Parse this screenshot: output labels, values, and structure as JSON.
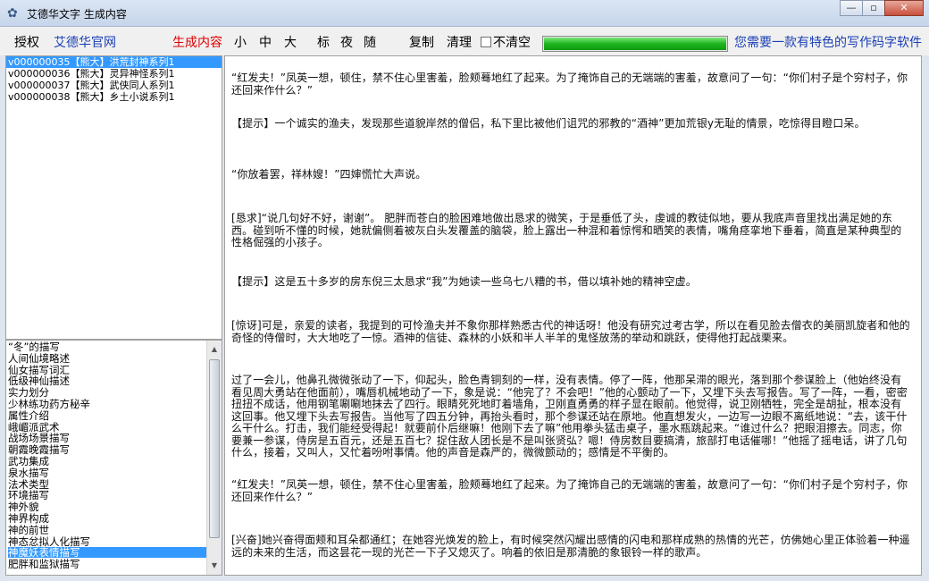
{
  "window": {
    "title": "艾德华文字 生成内容",
    "minimize": "—",
    "maximize": "▫",
    "close": "✕"
  },
  "toolbar": {
    "auth": "授权",
    "official": "艾德华官网",
    "generate": "生成内容",
    "size_small": "小",
    "size_mid": "中",
    "size_large": "大",
    "style_std": "标",
    "style_night": "夜",
    "style_random": "随",
    "copy": "复制",
    "clear": "清理",
    "no_clear": "不清空",
    "progress_pct": 100,
    "slogan": "您需要一款有特色的写作码字软件"
  },
  "list": [
    {
      "text": "v000000035【熊大】洪荒封神系列1",
      "selected": true
    },
    {
      "text": "v000000036【熊大】灵异神怪系列1",
      "selected": false
    },
    {
      "text": "v000000037【熊大】武侠同人系列1",
      "selected": false
    },
    {
      "text": "v000000038【熊大】乡土小说系列1",
      "selected": false
    }
  ],
  "sidebar": [
    "“冬”的描写",
    "人间仙境略述",
    "仙女描写词汇",
    "低级神仙描述",
    "实力划分",
    "少林练功药方秘辛",
    "属性介绍",
    "峨嵋派武术",
    "战场场景描写",
    "朝霞晚霞描写",
    "武功集成",
    "泉水描写",
    "法术类型",
    "环境描写",
    "神外貌",
    "神界构成",
    "神的前世",
    "神态忿拟人化描写",
    "神魔妖表情描写",
    "肥胖和监狱描写"
  ],
  "sidebar_selected": 18,
  "paragraphs": [
    "“红发夫！”凤英一想，顿住，禁不住心里害羞，脸颊蓦地红了起来。为了掩饰自己的无端端的害羞，故意问了一句：“你们村子是个穷村子，你还回来作什么？”",
    "【提示】一个诚实的渔夫，发现那些道貌岸然的僧侣，私下里比被他们诅咒的邪教的“酒神”更加荒银y无耻的情景，吃惊得目瞪口呆。",
    "“你放着罢，祥林嫂！”四婶慌忙大声说。",
    "[恳求]“说几句好不好，谢谢”。 肥胖而苍白的脸困难地做出恳求的微笑，于是垂低了头，虔诚的教徒似地，要从我底声音里找出满足她的东西。碰到听不懂的时候，她就偏侧着被灰白头发覆盖的脑袋，脸上露出一种混和着惊愕和晒笑的表情，嘴角痉挛地下垂着，简直是某种典型的性格倔强的小孩子。",
    "【提示】这是五十多岁的房东倪三太恳求“我”为她读一些乌七八糟的书，借以填补她的精神空虚。",
    "[惊讶]可是，亲爱的读者，我提到的可怜渔夫并不象你那样熟悉古代的神话呀！他没有研究过考古学，所以在看见脸去僧衣的美丽凯旋者和他的奇怪的侍僧时，大大地吃了一惊。酒神的信徒、森林的小妖和半人半羊的鬼怪放荡的举动和跳跃，使得他打起战栗来。",
    "过了一会儿，他鼻孔微微张动了一下，仰起头，脸色青铜刻的一样，没有表情。停了一阵，他那呆滞的眼光，落到那个参谋脸上（他始终没有看见周大勇站在他面前），嘴唇机械地动了一下，象是说：“他完了？不会吧！”他的心颤动了一下，又埋下头去写报告。写了一阵，一看，密密扭扭不成话，他用钢笔唰唰地抹去了四行。眼睛死死地盯着墙角，卫刚直勇勇的样子显在眼前。他觉得，说卫刚牺牲，完全是胡扯，根本没有这回事。他又埋下头去写报告。当他写了四五分钟，再抬头看时，那个参谋还站在原地。他直想发火，一边写一边眼不离纸地说：“去，该干什么干什么。打击，我们能经受得起！就要前仆后继嘛！他刚下去了嘛”他用拳头猛击桌子，墨水瓶跳起来。“谁过什么？把眼泪擦去。同志，你要兼一参谋，侍房是五百元，还是五百七？捉住敌人团长是不是叫张贤弘？嗯！侍房数目要搞清，旅部打电话催哪！”他摇了摇电话，讲了几句什么，接着，又叫人，又忙着吩咐事情。他的声音是森严的，微微颤动的；感情是不平衡的。",
    "“红发夫！”凤英一想，顿住，禁不住心里害羞，脸颊蓦地红了起来。为了掩饰自己的无端端的害羞，故意问了一句：“你们村子是个穷村子，你还回来作什么？”",
    "[兴奋]她兴奋得面颊和耳朵都通红；在她容光焕发的脸上，有时候突然闪耀出感情的闪电和那样成熟的热情的光芒，仿佛她心里正体验着一种遥远的未来的生活，而这昙花一现的光芒一下子又熄灭了。响着的依旧是那清脆的象银铃一样的歌声。"
  ]
}
